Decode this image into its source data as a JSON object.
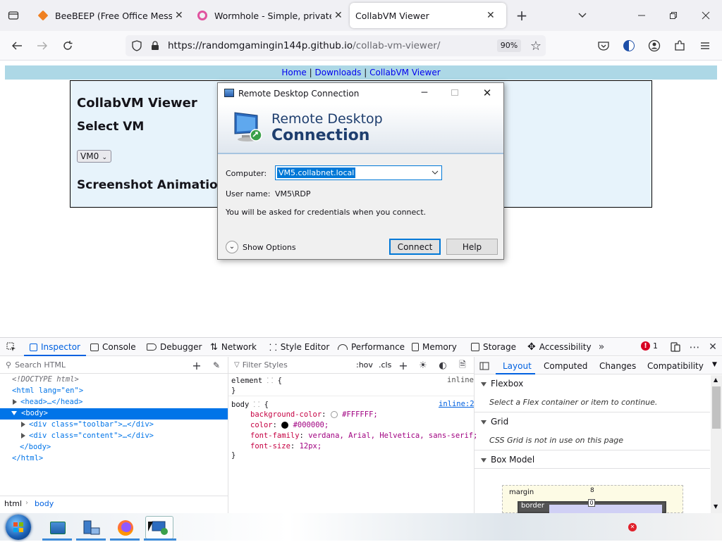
{
  "browser": {
    "tabs": [
      {
        "title": "BeeBEEP (Free Office Messenge"
      },
      {
        "title": "Wormhole - Simple, private file"
      },
      {
        "title": "CollabVM Viewer"
      }
    ],
    "url_domain": "https://randomgamingin144p.github.io",
    "url_path": "/collab-vm-viewer/",
    "zoom": "90%"
  },
  "page": {
    "nav_links": [
      "Home",
      "Downloads",
      "CollabVM Viewer"
    ],
    "nav_sep": "|",
    "title": "CollabVM Viewer",
    "select_vm": "Select VM",
    "vm_value": "VM0",
    "section": "Screenshot Animation"
  },
  "rdp": {
    "window_title": "Remote Desktop Connection",
    "banner_line1": "Remote Desktop",
    "banner_line2": "Connection",
    "computer_label": "Computer:",
    "computer_value": "VM5.collabnet.local",
    "username_label": "User name:",
    "username_value": "VM5\\RDP",
    "note": "You will be asked for credentials when you connect.",
    "show_options": "Show Options",
    "connect": "Connect",
    "help": "Help"
  },
  "devtools": {
    "tabs": [
      "Inspector",
      "Console",
      "Debugger",
      "Network",
      "Style Editor",
      "Performance",
      "Memory",
      "Storage",
      "Accessibility"
    ],
    "error_count": "1",
    "search_placeholder": "Search HTML",
    "html_lines": [
      {
        "text": "<!DOCTYPE html>",
        "indent": 0
      },
      {
        "text": "<html lang=\"en\">",
        "indent": 0
      },
      {
        "text": "<head>…</head>",
        "indent": 1
      },
      {
        "text": "<body>",
        "indent": 1
      },
      {
        "text": "<div class=\"toolbar\">…</div>",
        "indent": 2
      },
      {
        "text": "<div class=\"content\">…</div>",
        "indent": 2
      },
      {
        "text": "</body>",
        "indent": 1
      },
      {
        "text": "</html>",
        "indent": 0
      }
    ],
    "breadcrumb": [
      "html",
      "body"
    ],
    "filter_placeholder": "Filter Styles",
    "hov": ":hov",
    "cls": ".cls",
    "rule_element": "element",
    "rule_element_src": "inline",
    "rule_body": "body",
    "rule_body_src": "inline:2",
    "props": [
      {
        "name": "background-color",
        "value": "#FFFFFF;"
      },
      {
        "name": "color",
        "value": "#000000;"
      },
      {
        "name": "font-family",
        "value": "verdana, Arial, Helvetica, sans-serif;"
      },
      {
        "name": "font-size",
        "value": "12px;"
      }
    ],
    "layout_tabs": [
      "Layout",
      "Computed",
      "Changes",
      "Compatibility"
    ],
    "flexbox": "Flexbox",
    "flexbox_note": "Select a Flex container or item to continue.",
    "grid": "Grid",
    "grid_note": "CSS Grid is not in use on this page",
    "boxmodel": "Box Model",
    "margin_label": "margin",
    "margin_value": "8",
    "border_label": "border",
    "border_value": "0"
  }
}
